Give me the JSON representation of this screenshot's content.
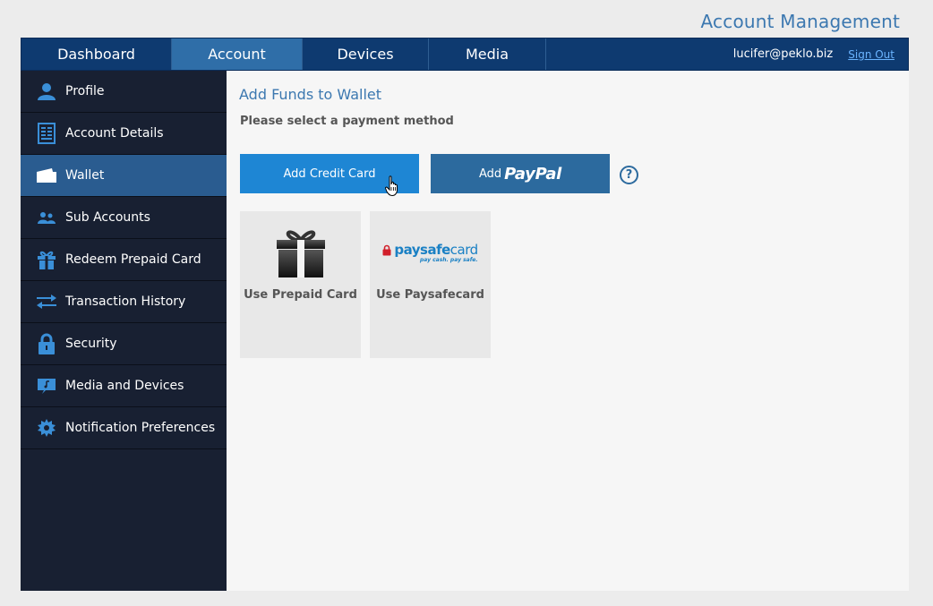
{
  "header": {
    "title": "Account Management"
  },
  "topnav": {
    "tabs": [
      {
        "label": "Dashboard"
      },
      {
        "label": "Account"
      },
      {
        "label": "Devices"
      },
      {
        "label": "Media"
      }
    ],
    "user_email": "lucifer@peklo.biz",
    "signout_label": "Sign Out"
  },
  "sidebar": {
    "items": [
      {
        "label": "Profile",
        "icon": "person-icon"
      },
      {
        "label": "Account Details",
        "icon": "document-icon"
      },
      {
        "label": "Wallet",
        "icon": "wallet-icon"
      },
      {
        "label": "Sub Accounts",
        "icon": "users-icon"
      },
      {
        "label": "Redeem Prepaid Card",
        "icon": "gift-icon"
      },
      {
        "label": "Transaction History",
        "icon": "transfer-arrows-icon"
      },
      {
        "label": "Security",
        "icon": "lock-icon"
      },
      {
        "label": "Media and Devices",
        "icon": "media-screen-icon"
      },
      {
        "label": "Notification Preferences",
        "icon": "badge-gear-icon"
      }
    ]
  },
  "main": {
    "title": "Add Funds to Wallet",
    "subtitle": "Please select a payment method",
    "credit_card_label": "Add Credit Card",
    "paypal_prefix": "Add",
    "paypal_brand": "PayPal",
    "help_glyph": "?",
    "tiles": [
      {
        "label": "Use Prepaid Card"
      },
      {
        "label": "Use Paysafecard"
      }
    ],
    "paysafe_logo": {
      "bold": "paysafe",
      "light": "card",
      "tagline": "pay cash. pay safe."
    }
  },
  "colors": {
    "accent": "#3c78b0",
    "nav_bg": "#0e3a70",
    "nav_active": "#2f6ea8",
    "sidebar_bg": "#182032",
    "sidebar_active": "#2a5c90",
    "primary_button": "#1e86d4",
    "paypal_button": "#2c6a9e"
  }
}
